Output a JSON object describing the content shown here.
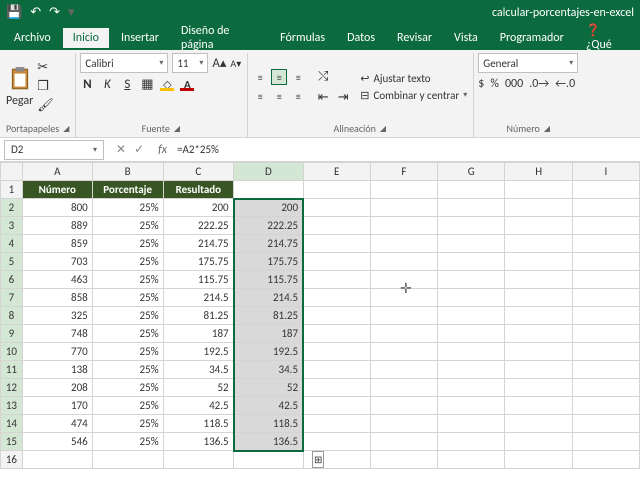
{
  "titlebar": {
    "filename": "calcular-porcentajes-en-excel"
  },
  "menu": {
    "items": [
      "Archivo",
      "Inicio",
      "Insertar",
      "Diseño de página",
      "Fórmulas",
      "Datos",
      "Revisar",
      "Vista",
      "Programador"
    ],
    "help_hint": "¿Qué",
    "active": "Inicio"
  },
  "ribbon": {
    "clipboard": {
      "paste": "Pegar",
      "label": "Portapapeles"
    },
    "font": {
      "name": "Calibri",
      "size": "11",
      "label": "Fuente"
    },
    "align": {
      "wrap": "Ajustar texto",
      "merge": "Combinar y centrar",
      "label": "Alineación"
    },
    "number": {
      "format": "General",
      "label": "Número"
    }
  },
  "namebox": "D2",
  "formula": "=A2*25%",
  "columns": [
    "A",
    "B",
    "C",
    "D",
    "E",
    "F",
    "G",
    "H",
    "I"
  ],
  "row_count": 16,
  "headers": {
    "A": "Número",
    "B": "Porcentaje",
    "C": "Resultado"
  },
  "data_rows": [
    {
      "r": 2,
      "A": "800",
      "B": "25%",
      "C": "200",
      "D": "200"
    },
    {
      "r": 3,
      "A": "889",
      "B": "25%",
      "C": "222.25",
      "D": "222.25"
    },
    {
      "r": 4,
      "A": "859",
      "B": "25%",
      "C": "214.75",
      "D": "214.75"
    },
    {
      "r": 5,
      "A": "703",
      "B": "25%",
      "C": "175.75",
      "D": "175.75"
    },
    {
      "r": 6,
      "A": "463",
      "B": "25%",
      "C": "115.75",
      "D": "115.75"
    },
    {
      "r": 7,
      "A": "858",
      "B": "25%",
      "C": "214.5",
      "D": "214.5"
    },
    {
      "r": 8,
      "A": "325",
      "B": "25%",
      "C": "81.25",
      "D": "81.25"
    },
    {
      "r": 9,
      "A": "748",
      "B": "25%",
      "C": "187",
      "D": "187"
    },
    {
      "r": 10,
      "A": "770",
      "B": "25%",
      "C": "192.5",
      "D": "192.5"
    },
    {
      "r": 11,
      "A": "138",
      "B": "25%",
      "C": "34.5",
      "D": "34.5"
    },
    {
      "r": 12,
      "A": "208",
      "B": "25%",
      "C": "52",
      "D": "52"
    },
    {
      "r": 13,
      "A": "170",
      "B": "25%",
      "C": "42.5",
      "D": "42.5"
    },
    {
      "r": 14,
      "A": "474",
      "B": "25%",
      "C": "118.5",
      "D": "118.5"
    },
    {
      "r": 15,
      "A": "546",
      "B": "25%",
      "C": "136.5",
      "D": "136.5"
    }
  ],
  "selection": {
    "col": "D",
    "from": 2,
    "to": 15
  }
}
